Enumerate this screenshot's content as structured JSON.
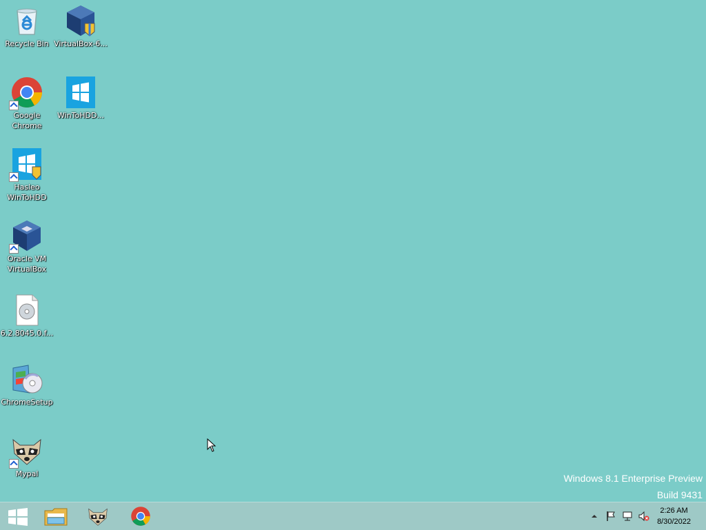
{
  "desktop": {
    "background_color": "#7bccc8",
    "icons": [
      {
        "label": "Recycle Bin",
        "icon": "recycle-bin-icon"
      },
      {
        "label": "VirtualBox-6...",
        "icon": "virtualbox-installer-icon"
      },
      {
        "label": "Google Chrome",
        "icon": "chrome-icon"
      },
      {
        "label": "WinToHDD...",
        "icon": "wintohdd-installer-icon"
      },
      {
        "label": "Hasleo WinToHDD",
        "icon": "wintohdd-icon"
      },
      {
        "label": "Oracle VM VirtualBox",
        "icon": "virtualbox-icon"
      },
      {
        "label": "6.2.8045.0.f...",
        "icon": "disc-image-file-icon"
      },
      {
        "label": "ChromeSetup",
        "icon": "chrome-setup-icon"
      },
      {
        "label": "Mypal",
        "icon": "mypal-icon"
      }
    ]
  },
  "watermark": {
    "line1": "Windows 8.1 Enterprise Preview",
    "line2": "Build 9431"
  },
  "taskbar": {
    "pinned": [
      {
        "name": "start",
        "icon": "windows-start-icon"
      },
      {
        "name": "file-explorer",
        "icon": "folder-icon"
      },
      {
        "name": "mypal",
        "icon": "mypal-icon"
      },
      {
        "name": "chrome",
        "icon": "chrome-icon"
      }
    ],
    "tray": {
      "icons": [
        "chevron-up-icon",
        "flag-icon",
        "network-icon",
        "speaker-muted-icon"
      ],
      "time": "2:26 AM",
      "date": "8/30/2022"
    }
  }
}
